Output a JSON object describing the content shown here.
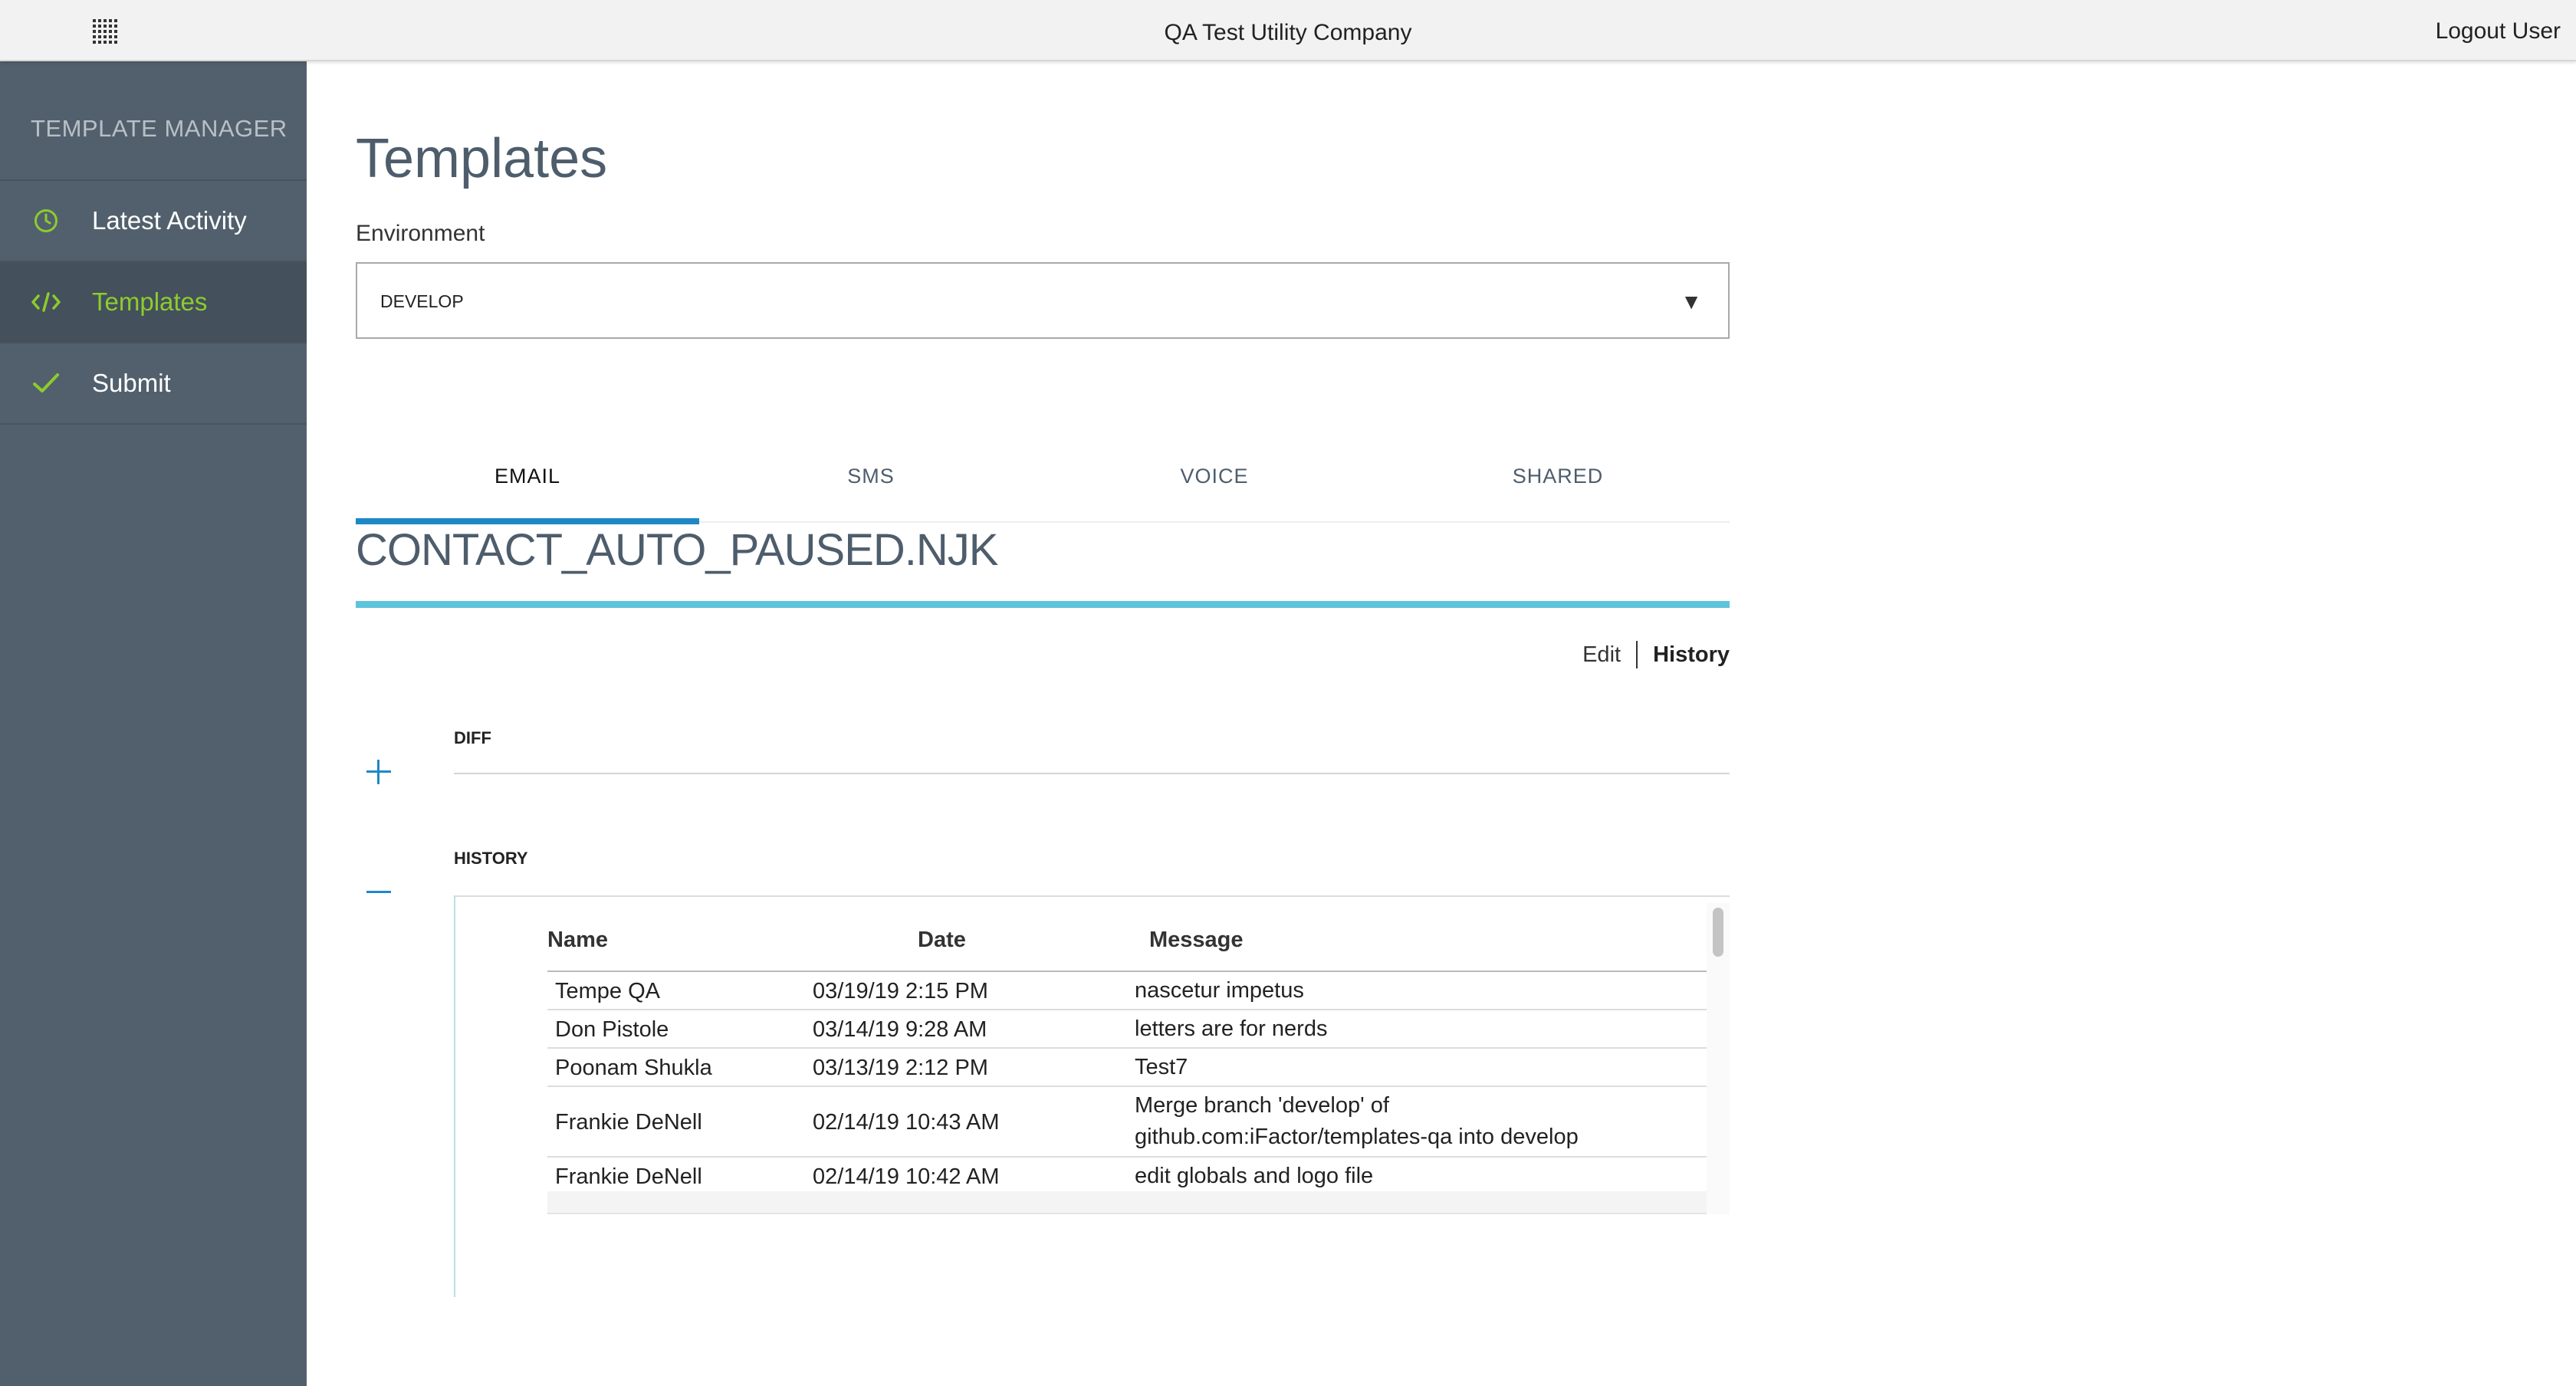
{
  "topbar": {
    "company": "QA Test Utility Company",
    "logout_label": "Logout User",
    "apps_icon": "apps-grid-icon"
  },
  "sidebar": {
    "title": "TEMPLATE MANAGER",
    "items": [
      {
        "label": "Latest Activity",
        "icon": "clock-icon",
        "active": false
      },
      {
        "label": "Templates",
        "icon": "code-icon",
        "active": true
      },
      {
        "label": "Submit",
        "icon": "check-icon",
        "active": false
      }
    ]
  },
  "main": {
    "title": "Templates",
    "environment": {
      "label": "Environment",
      "value": "DEVELOP"
    },
    "tabs": [
      {
        "label": "EMAIL",
        "active": true
      },
      {
        "label": "SMS",
        "active": false
      },
      {
        "label": "VOICE",
        "active": false
      },
      {
        "label": "SHARED",
        "active": false
      }
    ],
    "template_name": "CONTACT_AUTO_PAUSED.NJK",
    "links": {
      "edit": "Edit",
      "history": "History"
    },
    "diff_title": "DIFF",
    "history_title": "HISTORY",
    "history": {
      "columns": {
        "name": "Name",
        "date": "Date",
        "message": "Message"
      },
      "rows": [
        {
          "name": "Tempe QA",
          "date": "03/19/19 2:15 PM",
          "message": [
            "nascetur impetus"
          ]
        },
        {
          "name": "Don Pistole",
          "date": "03/14/19 9:28 AM",
          "message": [
            "letters are for nerds"
          ]
        },
        {
          "name": "Poonam Shukla",
          "date": "03/13/19 2:12 PM",
          "message": [
            "Test7"
          ]
        },
        {
          "name": "Frankie DeNell",
          "date": "02/14/19 10:43 AM",
          "message": [
            "Merge branch 'develop' of",
            "github.com:iFactor/templates-qa into develop"
          ]
        },
        {
          "name": "Frankie DeNell",
          "date": "02/14/19 10:42 AM",
          "message": [
            "edit globals and logo file"
          ]
        }
      ]
    }
  },
  "colors": {
    "sidebar_bg": "#52606d",
    "active_accent": "#8ccc2e",
    "tab_accent": "#1e88c7",
    "title_underline": "#5fc3dc"
  }
}
